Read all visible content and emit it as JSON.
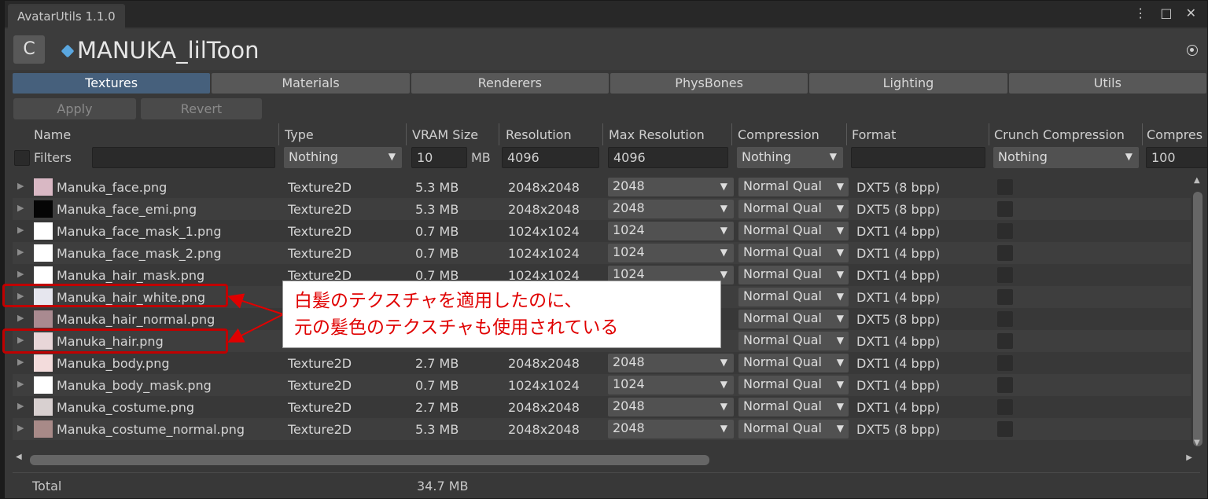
{
  "window": {
    "title": "AvatarUtils 1.1.0",
    "controls": "⋮ □ ✕"
  },
  "header": {
    "refresh_glyph": "C",
    "avatar_name": "MANUKA_lilToon"
  },
  "tabs": [
    "Textures",
    "Materials",
    "Renderers",
    "PhysBones",
    "Lighting",
    "Utils"
  ],
  "actions": {
    "apply": "Apply",
    "revert": "Revert"
  },
  "columns": {
    "name": "Name",
    "type": "Type",
    "vram": "VRAM Size",
    "resolution": "Resolution",
    "max_resolution": "Max Resolution",
    "compression": "Compression",
    "format": "Format",
    "crunch": "Crunch Compression",
    "compressor_quality": "Compres"
  },
  "filters": {
    "label": "Filters",
    "name": "",
    "type": "Nothing",
    "vram": "10",
    "vram_unit": "MB",
    "resolution": "4096",
    "max_resolution": "4096",
    "compression": "Nothing",
    "format": "",
    "crunch": "Nothing",
    "quality": "100"
  },
  "rows": [
    {
      "name": "Manuka_face.png",
      "type": "Texture2D",
      "vram": "5.3 MB",
      "resolution": "2048x2048",
      "max": "2048",
      "comp": "Normal Qual",
      "format": "DXT5 (8 bpp)",
      "thumb": "#d9b8c4"
    },
    {
      "name": "Manuka_face_emi.png",
      "type": "Texture2D",
      "vram": "5.3 MB",
      "resolution": "2048x2048",
      "max": "2048",
      "comp": "Normal Qual",
      "format": "DXT5 (8 bpp)",
      "thumb": "#050505"
    },
    {
      "name": "Manuka_face_mask_1.png",
      "type": "Texture2D",
      "vram": "0.7 MB",
      "resolution": "1024x1024",
      "max": "1024",
      "comp": "Normal Qual",
      "format": "DXT1 (4 bpp)",
      "thumb": "#ffffff"
    },
    {
      "name": "Manuka_face_mask_2.png",
      "type": "Texture2D",
      "vram": "0.7 MB",
      "resolution": "1024x1024",
      "max": "1024",
      "comp": "Normal Qual",
      "format": "DXT1 (4 bpp)",
      "thumb": "#ffffff"
    },
    {
      "name": "Manuka_hair_mask.png",
      "type": "Texture2D",
      "vram": "0.7 MB",
      "resolution": "1024x1024",
      "max": "1024",
      "comp": "Normal Qual",
      "format": "DXT1 (4 bpp)",
      "thumb": "#ffffff"
    },
    {
      "name": "Manuka_hair_white.png",
      "type": "",
      "vram": "",
      "resolution": "",
      "max": "",
      "comp": "Normal Qual",
      "format": "DXT1 (4 bpp)",
      "thumb": "#e6e6ee"
    },
    {
      "name": "Manuka_hair_normal.png",
      "type": "",
      "vram": "",
      "resolution": "",
      "max": "",
      "comp": "Normal Qual",
      "format": "DXT5 (8 bpp)",
      "thumb": "#a98a90"
    },
    {
      "name": "Manuka_hair.png",
      "type": "",
      "vram": "",
      "resolution": "",
      "max": "",
      "comp": "Normal Qual",
      "format": "DXT1 (4 bpp)",
      "thumb": "#e8d6d8"
    },
    {
      "name": "Manuka_body.png",
      "type": "Texture2D",
      "vram": "2.7 MB",
      "resolution": "2048x2048",
      "max": "2048",
      "comp": "Normal Qual",
      "format": "DXT1 (4 bpp)",
      "thumb": "#f3dcdc"
    },
    {
      "name": "Manuka_body_mask.png",
      "type": "Texture2D",
      "vram": "0.7 MB",
      "resolution": "1024x1024",
      "max": "1024",
      "comp": "Normal Qual",
      "format": "DXT1 (4 bpp)",
      "thumb": "#ffffff"
    },
    {
      "name": "Manuka_costume.png",
      "type": "Texture2D",
      "vram": "2.7 MB",
      "resolution": "2048x2048",
      "max": "2048",
      "comp": "Normal Qual",
      "format": "DXT1 (4 bpp)",
      "thumb": "#d8d0d0"
    },
    {
      "name": "Manuka_costume_normal.png",
      "type": "Texture2D",
      "vram": "5.3 MB",
      "resolution": "2048x2048",
      "max": "2048",
      "comp": "Normal Qual",
      "format": "DXT5 (8 bpp)",
      "thumb": "#a88a88"
    }
  ],
  "total": {
    "label": "Total",
    "value": "34.7 MB"
  },
  "annotation": {
    "line1": "白髪のテクスチャを適用したのに、",
    "line2": "元の髪色のテクスチャも使用されている",
    "color": "#e00000"
  }
}
